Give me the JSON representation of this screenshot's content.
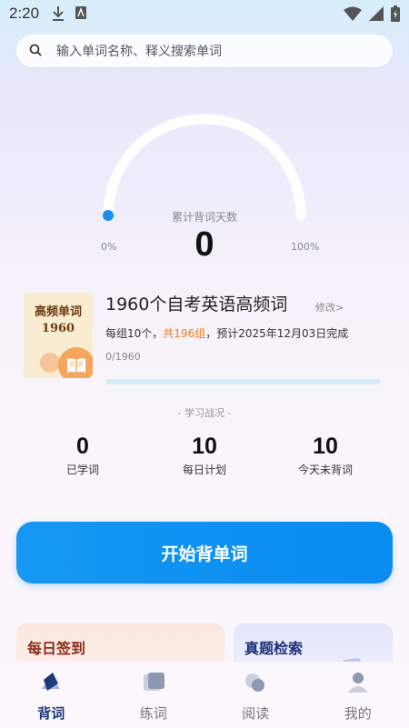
{
  "status_bar": {
    "time": "2:20"
  },
  "search": {
    "placeholder": "输入单词名称、释义搜索单词"
  },
  "gauge": {
    "caption": "累计背词天数",
    "value": "0",
    "min_label": "0%",
    "max_label": "100%",
    "progress": 0
  },
  "book": {
    "cover_title": "高频单词",
    "cover_year": "1960",
    "title": "1960个自考英语高频词",
    "edit_label": "修改>",
    "plan_prefix": "每组10个，",
    "plan_highlight": "共196组",
    "plan_suffix": "，预计2025年12月03日完成",
    "progress_text": "0/1960",
    "progress_fraction": 0
  },
  "stats": {
    "heading": "- 学习战况 -",
    "items": [
      {
        "value": "0",
        "label": "已学词"
      },
      {
        "value": "10",
        "label": "每日计划"
      },
      {
        "value": "10",
        "label": "今天未背词"
      }
    ]
  },
  "start_button": {
    "label": "开始背单词"
  },
  "cards": {
    "checkin": "每日签到",
    "search": "真题检索"
  },
  "tabs": [
    {
      "label": "背词",
      "icon": "book-icon",
      "active": true
    },
    {
      "label": "练词",
      "icon": "practice-icon",
      "active": false
    },
    {
      "label": "阅读",
      "icon": "reading-icon",
      "active": false
    },
    {
      "label": "我的",
      "icon": "profile-icon",
      "active": false
    }
  ],
  "colors": {
    "accent": "#0a8cf0",
    "highlight": "#f07c1b",
    "active_tab": "#1d3a7a"
  }
}
